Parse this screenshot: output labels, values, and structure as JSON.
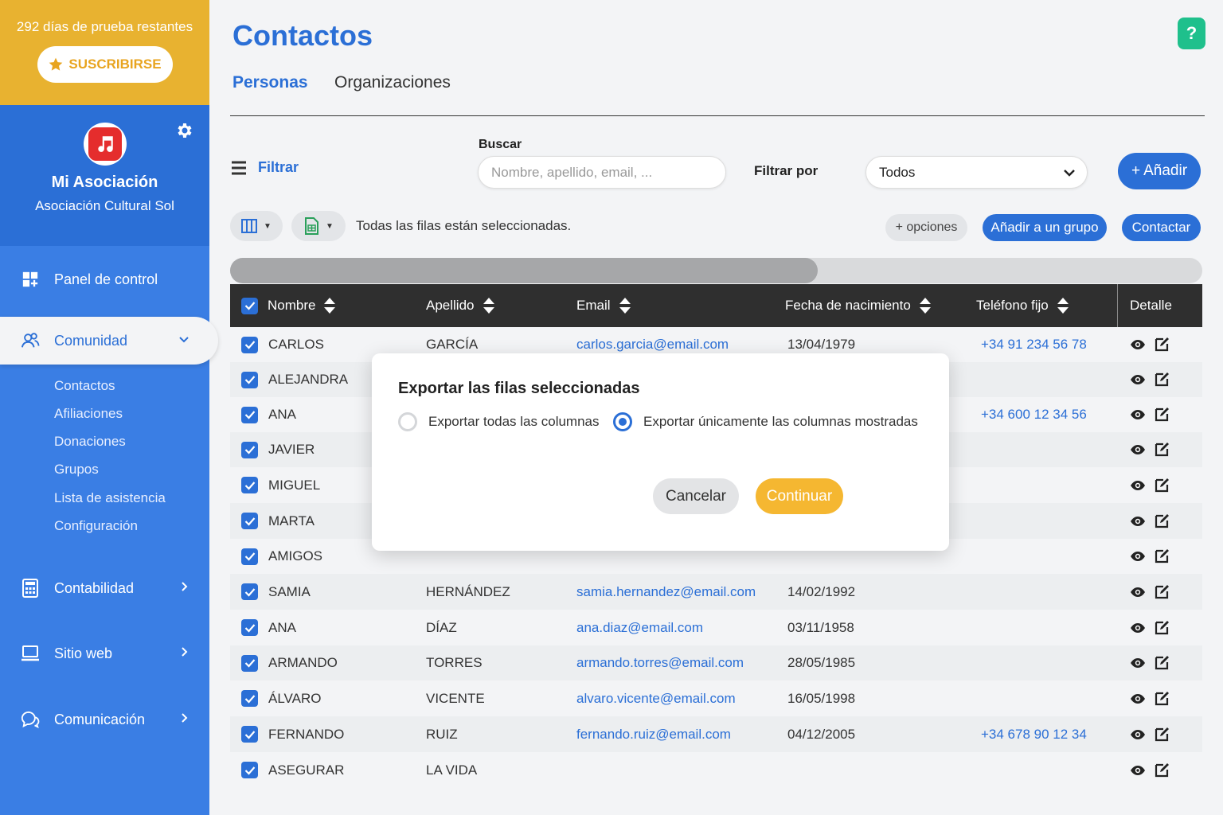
{
  "sidebar": {
    "trial_text": "292 días de prueba restantes",
    "subscribe_label": "SUSCRIBIRSE",
    "org_name": "Mi Asociación",
    "org_subtitle": "Asociación Cultural Sol",
    "nav": [
      {
        "label": "Panel de control",
        "icon": "dashboard-icon"
      },
      {
        "label": "Comunidad",
        "icon": "community-icon",
        "active": true
      },
      {
        "label": "Contabilidad",
        "icon": "calculator-icon"
      },
      {
        "label": "Sitio web",
        "icon": "laptop-icon"
      },
      {
        "label": "Comunicación",
        "icon": "chat-icon"
      }
    ],
    "sub_items": [
      "Contactos",
      "Afiliaciones",
      "Donaciones",
      "Grupos",
      "Lista de asistencia",
      "Configuración"
    ],
    "colors": {
      "trial_bg": "#e8b230",
      "sidebar_bg": "#3a7ee4",
      "header_bg": "#2b6fd6"
    }
  },
  "header": {
    "title": "Contactos",
    "help_label": "?",
    "tabs": [
      {
        "label": "Personas",
        "active": true
      },
      {
        "label": "Organizaciones",
        "active": false
      }
    ]
  },
  "filters": {
    "filter_toggle_label": "Filtrar",
    "search_label": "Buscar",
    "search_placeholder": "Nombre, apellido, email, ...",
    "filter_by_label": "Filtrar por",
    "filter_by_value": "Todos",
    "add_label": "Añadir"
  },
  "toolbar": {
    "selection_text": "Todas las filas están seleccionadas.",
    "options_label": "+ opciones",
    "add_group_label": "Añadir a un grupo",
    "contact_label": "Contactar"
  },
  "table": {
    "columns": [
      "Nombre",
      "Apellido",
      "Email",
      "Fecha de nacimiento",
      "Teléfono fijo",
      "Detalle"
    ],
    "rows": [
      {
        "nombre": "CARLOS",
        "apellido": "GARCÍA",
        "email": "carlos.garcia@email.com",
        "fecha": "13/04/1979",
        "telefono": "+34 91 234 56 78"
      },
      {
        "nombre": "ALEJANDRA",
        "apellido": "",
        "email": "",
        "fecha": "",
        "telefono": ""
      },
      {
        "nombre": "ANA",
        "apellido": "",
        "email": "",
        "fecha": "",
        "telefono": "+34 600 12 34 56"
      },
      {
        "nombre": "JAVIER",
        "apellido": "",
        "email": "",
        "fecha": "",
        "telefono": ""
      },
      {
        "nombre": "MIGUEL",
        "apellido": "",
        "email": "",
        "fecha": "",
        "telefono": ""
      },
      {
        "nombre": "MARTA",
        "apellido": "",
        "email": "",
        "fecha": "",
        "telefono": ""
      },
      {
        "nombre": "AMIGOS",
        "apellido": "",
        "email": "",
        "fecha": "",
        "telefono": ""
      },
      {
        "nombre": "SAМIA",
        "apellido": "HERNÁNDEZ",
        "email": "samia.hernandez@email.com",
        "fecha": "14/02/1992",
        "telefono": ""
      },
      {
        "nombre": "ANA",
        "apellido": "DÍAZ",
        "email": "ana.diaz@email.com",
        "fecha": "03/11/1958",
        "telefono": ""
      },
      {
        "nombre": "ARMANDO",
        "apellido": "TORRES",
        "email": "armando.torres@email.com",
        "fecha": "28/05/1985",
        "telefono": ""
      },
      {
        "nombre": "ÁLVARO",
        "apellido": "VICENTE",
        "email": "alvaro.vicente@email.com",
        "fecha": "16/05/1998",
        "telefono": ""
      },
      {
        "nombre": "FERNANDO",
        "apellido": "RUIZ",
        "email": "fernando.ruiz@email.com",
        "fecha": "04/12/2005",
        "telefono": "+34 678 90 12 34"
      },
      {
        "nombre": "ASEGURAR",
        "apellido": "LA VIDA",
        "email": "",
        "fecha": "",
        "telefono": ""
      }
    ]
  },
  "modal": {
    "title": "Exportar las filas seleccionadas",
    "option_all": "Exportar todas las columnas",
    "option_shown": "Exportar únicamente las columnas mostradas",
    "selected_option": "shown",
    "cancel_label": "Cancelar",
    "continue_label": "Continuar"
  }
}
